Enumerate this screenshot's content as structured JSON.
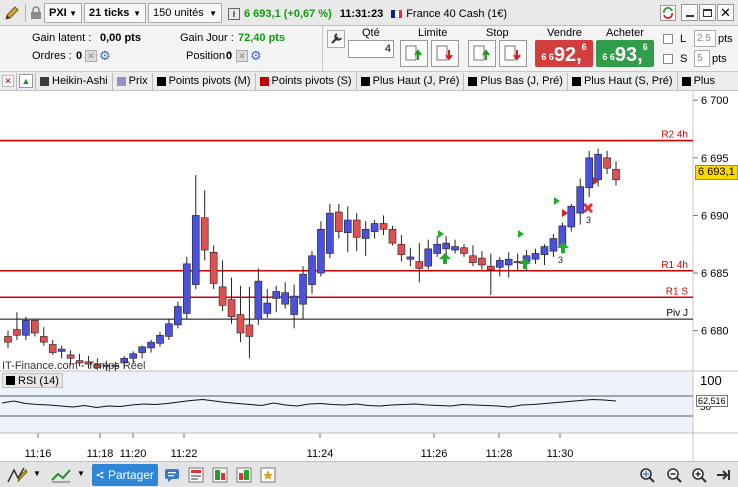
{
  "toolbar": {
    "symbol": "PXI",
    "interval": "21 ticks",
    "units": "150 unités",
    "quote": "6 693,1 (+0,67 %)",
    "time": "11:31:23",
    "instrument": "France 40 Cash (1€)"
  },
  "positions": {
    "gain_latent_label": "Gain latent :",
    "gain_latent_value": "0,00 pts",
    "gain_jour_label": "Gain Jour :",
    "gain_jour_value": "72,40 pts",
    "ordres_label": "Ordres :",
    "ordres_value": "0",
    "position_label": "Position :",
    "position_value": "0"
  },
  "order": {
    "qty_label": "Qté",
    "qty_value": "4",
    "limit_label": "Limite",
    "stop_label": "Stop",
    "sell_label": "Vendre",
    "buy_label": "Acheter",
    "sell_price_small": "6 6",
    "sell_price_big": "92,",
    "sell_price_sup": "6",
    "buy_price_small": "6 6",
    "buy_price_big": "93,",
    "buy_price_sup": "6",
    "l_label": "L",
    "l_value": "2.5",
    "l_unit": "pts",
    "s_label": "S",
    "s_value": "5",
    "s_unit": "pts"
  },
  "indicators": [
    {
      "label": "Heikin-Ashi",
      "color": "#3a3a3a"
    },
    {
      "label": "Prix",
      "color": "#9a8ad0"
    },
    {
      "label": "Points pivots (M)",
      "color": "#000000"
    },
    {
      "label": "Points pivots (S)",
      "color": "#c00000"
    },
    {
      "label": "Plus Haut (J, Pré)",
      "color": "#000000"
    },
    {
      "label": "Plus Bas (J, Pré)",
      "color": "#000000"
    },
    {
      "label": "Plus Haut (S, Pré)",
      "color": "#000000"
    },
    {
      "label": "Plus",
      "color": "#000000"
    }
  ],
  "chart": {
    "watermark": "IT-Finance.com - Temps Réel",
    "current_price_label": "6 693,1",
    "levels": [
      {
        "name": "R2 4h",
        "value": 6696.5,
        "color": "#d00000"
      },
      {
        "name": "R1 4h",
        "value": 6685.2,
        "color": "#d00000"
      },
      {
        "name": "R1 S",
        "value": 6682.9,
        "color": "#d00000"
      },
      {
        "name": "Piv J",
        "value": 6681.0,
        "color": "#000000"
      }
    ],
    "y_ticks": [
      "6 700",
      "6 695",
      "6 690",
      "6 685",
      "6 680"
    ],
    "x_ticks": [
      "11:16",
      "11:18",
      "11:20",
      "11:22",
      "11:24",
      "11:26",
      "11:28",
      "11:30"
    ],
    "marker_labels": [
      "3",
      "3"
    ],
    "rsi": {
      "label": "RSI (14)",
      "ticks": [
        "100",
        "50"
      ],
      "current": "62,516",
      "values": [
        56,
        60,
        55,
        53,
        52,
        50,
        48,
        51,
        47,
        50,
        49,
        52,
        54,
        53,
        55,
        58,
        61,
        63,
        60,
        57,
        55,
        53,
        51,
        56,
        52,
        50,
        54,
        55,
        53,
        52,
        54,
        51,
        50,
        52,
        53,
        54,
        52,
        51,
        50,
        53,
        52,
        51,
        50,
        48,
        52,
        53,
        55,
        57,
        59,
        61,
        63,
        62,
        60
      ]
    }
  },
  "chart_data": {
    "type": "candlestick",
    "ylim": [
      6676.5,
      6700.8
    ],
    "candles": [
      [
        6679.5,
        6680.0,
        6678.5,
        6679.0
      ],
      [
        6680.1,
        6681.6,
        6679.2,
        6679.6
      ],
      [
        6679.6,
        6681.2,
        6679.2,
        6680.9
      ],
      [
        6680.9,
        6681.0,
        6679.5,
        6679.8
      ],
      [
        6679.5,
        6680.3,
        6678.7,
        6679.0
      ],
      [
        6678.8,
        6679.2,
        6677.9,
        6678.1
      ],
      [
        6678.2,
        6678.7,
        6677.6,
        6678.4
      ],
      [
        6677.9,
        6678.3,
        6677.0,
        6677.6
      ],
      [
        6677.4,
        6678.0,
        6676.9,
        6677.2
      ],
      [
        6677.3,
        6677.8,
        6676.7,
        6677.1
      ],
      [
        6677.1,
        6677.6,
        6676.6,
        6676.8
      ],
      [
        6676.9,
        6677.4,
        6676.5,
        6677.0
      ],
      [
        6677.0,
        6677.3,
        6676.5,
        6676.9
      ],
      [
        6677.2,
        6677.8,
        6676.8,
        6677.6
      ],
      [
        6677.6,
        6678.2,
        6677.2,
        6678.0
      ],
      [
        6678.1,
        6678.7,
        6677.6,
        6678.6
      ],
      [
        6678.5,
        6679.2,
        6678.1,
        6679.0
      ],
      [
        6678.9,
        6679.9,
        6678.6,
        6679.6
      ],
      [
        6679.5,
        6681.0,
        6679.2,
        6680.6
      ],
      [
        6680.5,
        6682.5,
        6680.2,
        6682.1
      ],
      [
        6681.5,
        6686.4,
        6681.0,
        6685.8
      ],
      [
        6684.0,
        6693.5,
        6683.6,
        6690.0
      ],
      [
        6689.8,
        6692.2,
        6686.1,
        6687.0
      ],
      [
        6686.8,
        6687.4,
        6683.6,
        6684.1
      ],
      [
        6683.8,
        6686.1,
        6681.7,
        6682.2
      ],
      [
        6682.7,
        6684.6,
        6680.6,
        6681.2
      ],
      [
        6681.4,
        6683.9,
        6679.0,
        6679.8
      ],
      [
        6680.5,
        6683.8,
        6677.6,
        6679.5
      ],
      [
        6681.0,
        6685.4,
        6680.5,
        6684.3
      ],
      [
        6681.5,
        6683.6,
        6681.1,
        6682.4
      ],
      [
        6682.8,
        6683.9,
        6681.6,
        6683.4
      ],
      [
        6682.3,
        6684.2,
        6681.9,
        6683.3
      ],
      [
        6681.4,
        6684.0,
        6680.2,
        6683.0
      ],
      [
        6682.3,
        6685.6,
        6681.0,
        6684.9
      ],
      [
        6684.0,
        6686.9,
        6683.2,
        6686.5
      ],
      [
        6685.0,
        6689.5,
        6684.7,
        6688.8
      ],
      [
        6686.7,
        6691.0,
        6686.3,
        6690.2
      ],
      [
        6690.3,
        6691.0,
        6688.0,
        6688.6
      ],
      [
        6688.5,
        6690.8,
        6686.8,
        6689.6
      ],
      [
        6689.6,
        6690.2,
        6686.9,
        6688.1
      ],
      [
        6688.0,
        6689.5,
        6686.5,
        6688.8
      ],
      [
        6688.6,
        6689.6,
        6688.0,
        6689.3
      ],
      [
        6689.3,
        6690.0,
        6688.3,
        6688.8
      ],
      [
        6688.8,
        6689.1,
        6687.4,
        6687.6
      ],
      [
        6687.5,
        6688.3,
        6686.0,
        6686.6
      ],
      [
        6686.2,
        6687.2,
        6685.6,
        6686.4
      ],
      [
        6686.0,
        6687.6,
        6684.2,
        6685.4
      ],
      [
        6685.6,
        6687.9,
        6685.3,
        6687.1
      ],
      [
        6686.7,
        6688.2,
        6686.4,
        6687.5
      ],
      [
        6687.1,
        6688.2,
        6686.3,
        6687.6
      ],
      [
        6687.0,
        6687.9,
        6686.7,
        6687.3
      ],
      [
        6687.2,
        6687.5,
        6686.4,
        6686.7
      ],
      [
        6686.5,
        6687.4,
        6685.6,
        6685.9
      ],
      [
        6686.3,
        6686.9,
        6685.3,
        6685.7
      ],
      [
        6685.6,
        6686.7,
        6683.1,
        6685.3
      ],
      [
        6685.5,
        6686.4,
        6684.7,
        6686.1
      ],
      [
        6685.7,
        6686.8,
        6684.6,
        6686.2
      ],
      [
        6686.0,
        6686.7,
        6685.2,
        6685.9
      ],
      [
        6686.0,
        6687.0,
        6685.2,
        6686.5
      ],
      [
        6686.2,
        6687.1,
        6685.8,
        6686.7
      ],
      [
        6686.6,
        6687.5,
        6685.7,
        6687.3
      ],
      [
        6686.9,
        6688.4,
        6686.4,
        6688.0
      ],
      [
        6687.3,
        6689.4,
        6686.7,
        6689.1
      ],
      [
        6689.0,
        6691.0,
        6688.6,
        6690.8
      ],
      [
        6690.2,
        6693.2,
        6689.2,
        6692.5
      ],
      [
        6692.4,
        6695.6,
        6691.6,
        6695.0
      ],
      [
        6693.1,
        6695.8,
        6692.5,
        6695.3
      ],
      [
        6695.0,
        6695.6,
        6693.6,
        6694.1
      ],
      [
        6694.0,
        6694.7,
        6692.6,
        6693.1
      ]
    ]
  }
}
